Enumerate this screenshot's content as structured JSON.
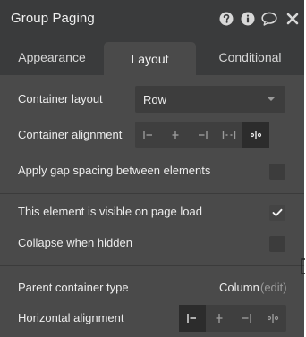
{
  "panel": {
    "title": "Group Paging",
    "header_icons": [
      "help-icon",
      "info-icon",
      "comment-icon",
      "close-icon"
    ]
  },
  "tabs": [
    {
      "label": "Appearance",
      "active": false
    },
    {
      "label": "Layout",
      "active": true
    },
    {
      "label": "Conditional",
      "active": false
    }
  ],
  "layout": {
    "container_layout": {
      "label": "Container layout",
      "value": "Row"
    },
    "container_alignment": {
      "label": "Container alignment",
      "options": [
        "align-start-icon",
        "align-center-icon",
        "align-end-icon",
        "space-between-icon",
        "space-around-icon"
      ],
      "selected_index": 4
    },
    "gap_spacing": {
      "label": "Apply gap spacing between elements",
      "checked": false
    },
    "visible_on_load": {
      "label": "This element is visible on page load",
      "checked": true
    },
    "collapse_when_hidden": {
      "label": "Collapse when hidden",
      "checked": false
    },
    "parent_container": {
      "label": "Parent container type",
      "value": "Column",
      "edit_label": "(edit)"
    },
    "horizontal_alignment": {
      "label": "Horizontal alignment",
      "options": [
        "align-left-icon",
        "align-center-icon",
        "align-right-icon",
        "space-around-icon"
      ],
      "selected_index": 0
    }
  },
  "colors": {
    "panel_bg": "#4a4a4a",
    "header_bg": "#3a3b3c",
    "control_bg": "#3d3d3d",
    "selected_bg": "#2c2c2c",
    "text": "#ececec",
    "muted": "#9a9a9a"
  }
}
